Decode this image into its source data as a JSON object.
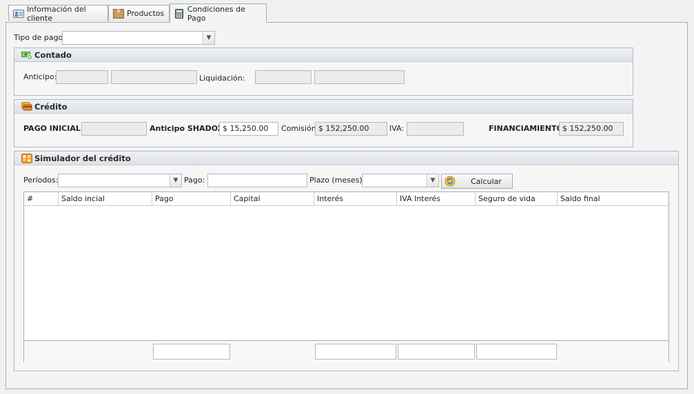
{
  "tabs": [
    {
      "label": "Información del cliente",
      "icon": "id-card-icon"
    },
    {
      "label": "Productos",
      "icon": "box-icon"
    },
    {
      "label": "Condiciones de Pago",
      "icon": "calculator-icon"
    }
  ],
  "tipo_pago": {
    "label": "Tipo de pago:",
    "value": ""
  },
  "contado": {
    "title": "Contado",
    "anticipo_label": "Anticipo:",
    "liquidacion_label": "Liquidación:"
  },
  "credito": {
    "title": "Crédito",
    "pago_inicial_label": "PAGO INICIAL:",
    "pago_inicial_value": "",
    "anticipo_label": "Anticipo SHADOX:",
    "anticipo_value": "$ 15,250.00",
    "comision_label": "Comisión:",
    "comision_value": "$ 152,250.00",
    "iva_label": "IVA:",
    "iva_value": "",
    "financiamiento_label": "FINANCIAMIENTO:",
    "financiamiento_value": "$ 152,250.00"
  },
  "simulador": {
    "title": "Simulador del crédito",
    "periodos_label": "Períodos:",
    "pago_label": "Pago:",
    "plazo_label": "Plazo (meses):",
    "calcular_label": "Calcular",
    "columns": [
      "#",
      "Saldo incial",
      "Pago",
      "Capital",
      "Interés",
      "IVA Interés",
      "Seguro de vida",
      "Saldo final"
    ]
  }
}
